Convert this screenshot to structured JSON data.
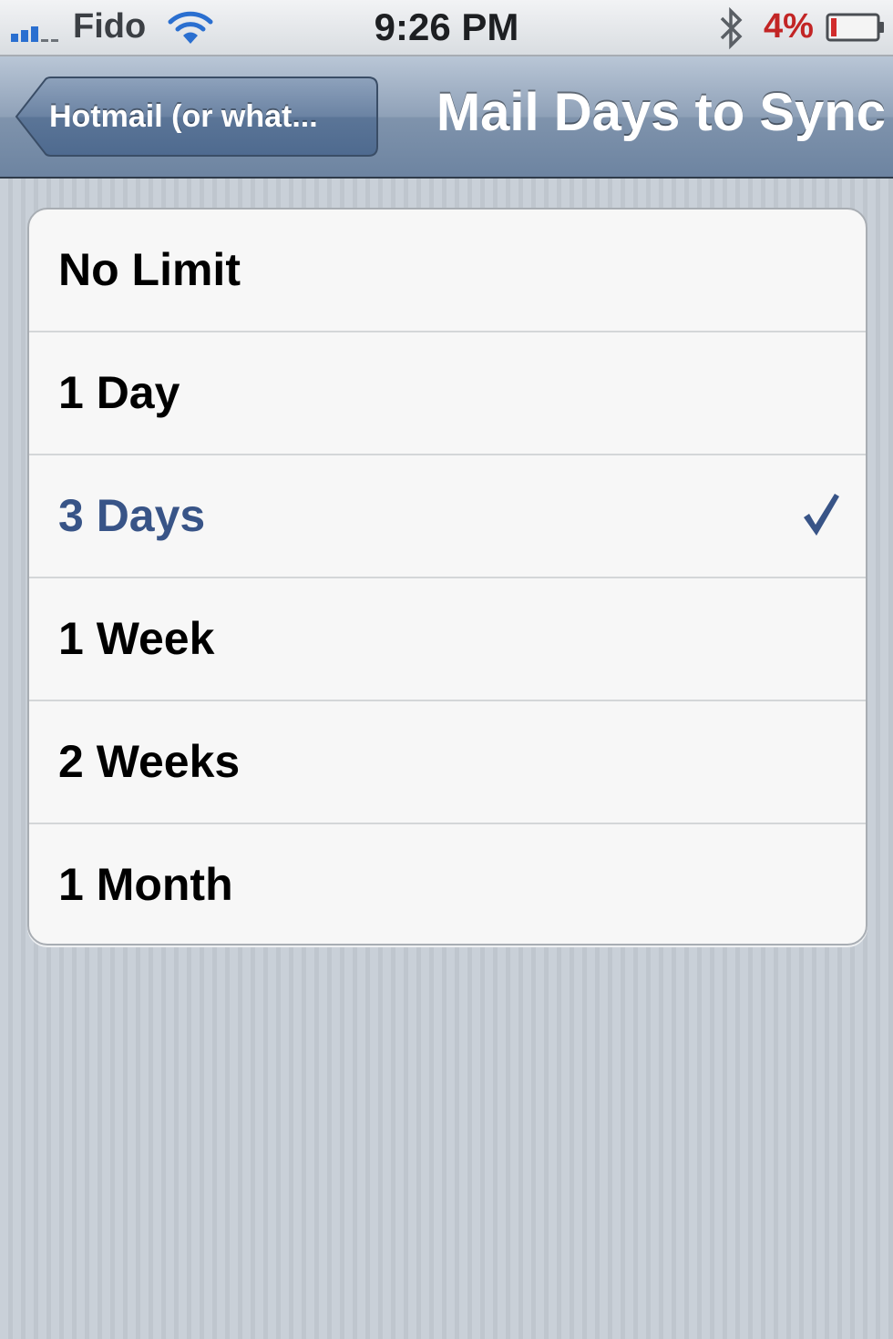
{
  "status_bar": {
    "carrier": "Fido",
    "time": "9:26 PM",
    "battery_percent": "4%",
    "signal_bars": 3,
    "signal_max": 5,
    "battery_level": 0.04,
    "icons": [
      "signal-icon",
      "wifi-icon",
      "bluetooth-icon",
      "battery-icon"
    ]
  },
  "nav": {
    "back_label": "Hotmail (or what...",
    "title": "Mail Days to Sync"
  },
  "options": [
    {
      "label": "No Limit",
      "selected": false
    },
    {
      "label": "1 Day",
      "selected": false
    },
    {
      "label": "3 Days",
      "selected": true
    },
    {
      "label": "1 Week",
      "selected": false
    },
    {
      "label": "2 Weeks",
      "selected": false
    },
    {
      "label": "1 Month",
      "selected": false
    }
  ],
  "colors": {
    "selected_text": "#385487",
    "battery_low": "#c22525",
    "signal": "#2a6fd0"
  }
}
